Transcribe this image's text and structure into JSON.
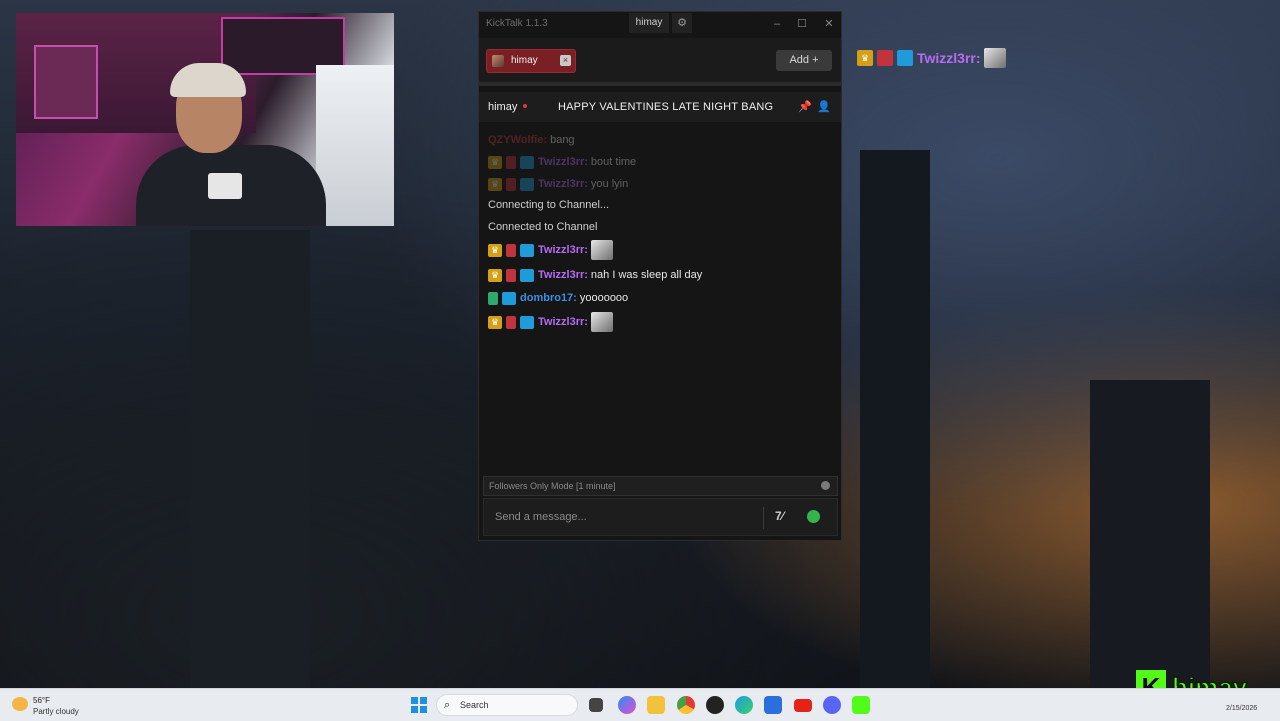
{
  "app": {
    "title": "KickTalk 1.1.3",
    "current_user": "himay",
    "tabs": [
      {
        "label": "himay"
      }
    ],
    "add_label": "Add",
    "channel": {
      "name": "himay",
      "title": "HAPPY VALENTINES LATE NIGHT BANG"
    },
    "messages": [
      {
        "type": "chat",
        "faded": true,
        "user": "QZYWolfie:",
        "text": "bang",
        "user_color": "#c23b3b",
        "badges": []
      },
      {
        "type": "chat",
        "faded": true,
        "user": "Twizzl3rr:",
        "text": "bout time",
        "user_color": "#b56cf2",
        "badges": [
          "crown-badge",
          "sub-badge",
          "cube-badge"
        ]
      },
      {
        "type": "chat",
        "faded": true,
        "user": "Twizzl3rr:",
        "text": "you lyin",
        "user_color": "#b56cf2",
        "badges": [
          "crown-badge",
          "sub-badge",
          "cube-badge"
        ]
      },
      {
        "type": "system",
        "text": "Connecting to Channel..."
      },
      {
        "type": "system",
        "text": "Connected to Channel"
      },
      {
        "type": "chat",
        "faded": false,
        "user": "Twizzl3rr:",
        "text": "",
        "user_color": "#b56cf2",
        "badges": [
          "crown-badge",
          "sub-badge",
          "cube-badge"
        ],
        "emote": true
      },
      {
        "type": "chat",
        "faded": false,
        "user": "Twizzl3rr:",
        "text": "nah I was sleep all day",
        "user_color": "#b56cf2",
        "badges": [
          "crown-badge",
          "sub-badge",
          "cube-badge"
        ]
      },
      {
        "type": "chat",
        "faded": false,
        "user": "dombro17:",
        "text": "yooooooo",
        "user_color": "#3b8fe6",
        "badges": [
          "green-badge",
          "cube-badge"
        ]
      },
      {
        "type": "chat",
        "faded": false,
        "user": "Twizzl3rr:",
        "text": "",
        "user_color": "#b56cf2",
        "badges": [
          "crown-badge",
          "sub-badge",
          "cube-badge"
        ],
        "emote": true
      }
    ],
    "followers_mode": "Followers Only Mode [1 minute]",
    "input_placeholder": "Send a message..."
  },
  "overlay": {
    "user": "Twizzl3rr:",
    "badges": [
      "crown-badge",
      "sub-badge",
      "cube-badge"
    ]
  },
  "stream_logo": {
    "name": "himay"
  },
  "taskbar": {
    "temperature": "56°F",
    "condition": "Partly cloudy",
    "search_label": "Search",
    "date": "2/15/2026"
  },
  "colors": {
    "accent": "#53fc18",
    "tab_active": "#7a1f24",
    "background": "#151515"
  }
}
